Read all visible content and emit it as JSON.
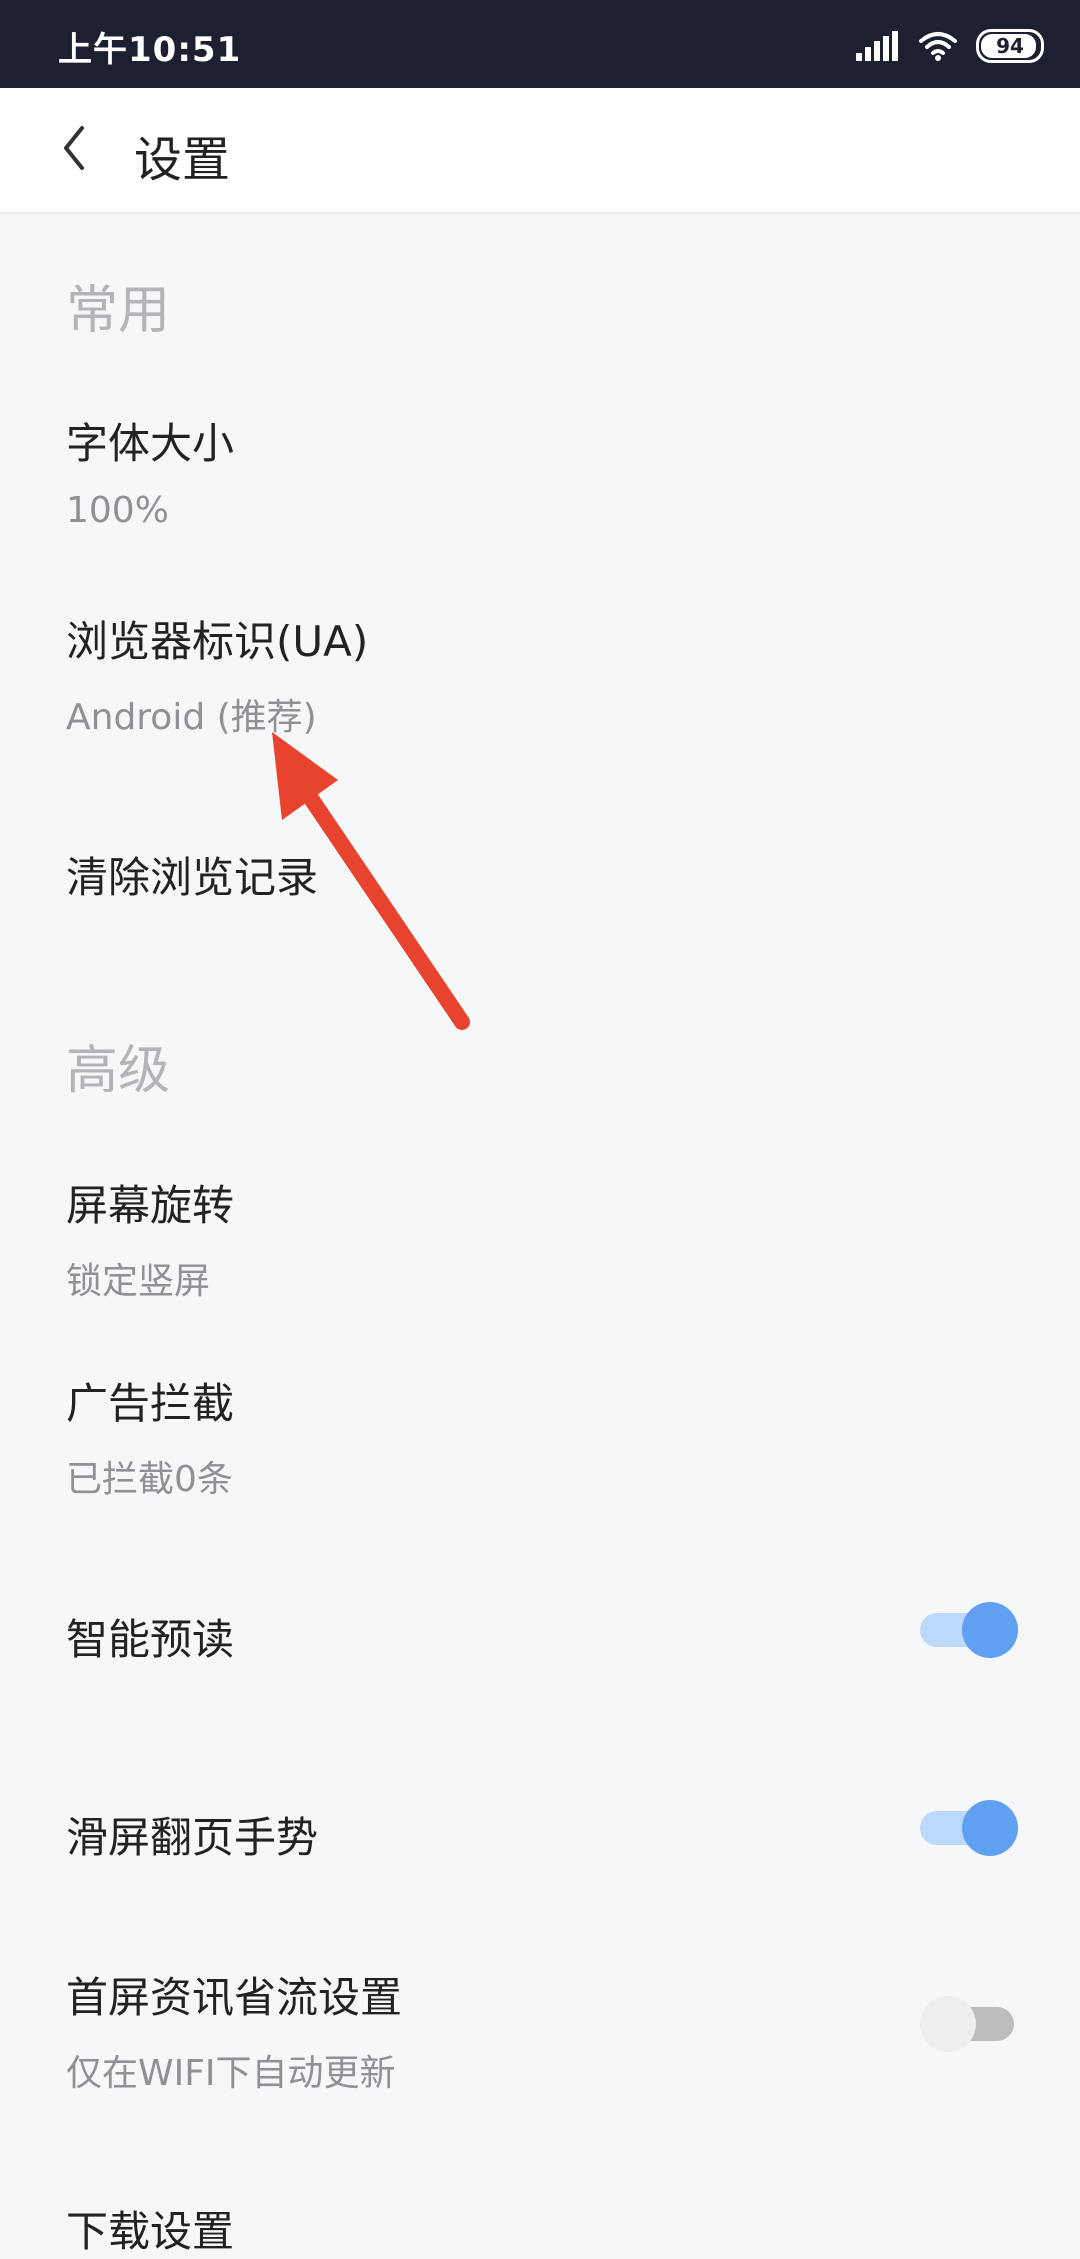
{
  "status_bar": {
    "time": "上午10:51",
    "battery": "94",
    "battery_level": 0.94
  },
  "header": {
    "title": "设置",
    "back_icon": "chevron-left-icon"
  },
  "sections": {
    "common": {
      "title": "常用",
      "font_size": {
        "title": "字体大小",
        "value": "100%"
      },
      "user_agent": {
        "title": "浏览器标识(UA)",
        "value": "Android (推荐)"
      },
      "clear_history": {
        "title": "清除浏览记录"
      }
    },
    "advanced": {
      "title": "高级",
      "screen_rotation": {
        "title": "屏幕旋转",
        "value": "锁定竖屏"
      },
      "ad_block": {
        "title": "广告拦截",
        "value": "已拦截0条"
      },
      "smart_preload": {
        "title": "智能预读",
        "enabled": true
      },
      "swipe_gesture": {
        "title": "滑屏翻页手势",
        "enabled": true
      },
      "data_saver": {
        "title": "首屏资讯省流设置",
        "value": "仅在WIFI下自动更新",
        "enabled": false
      },
      "download_settings": {
        "title": "下载设置"
      }
    }
  },
  "colors": {
    "status_bar_bg": "#1c2030",
    "toggle_on": "#5fa0f2",
    "annotation_arrow": "#e8432e"
  }
}
